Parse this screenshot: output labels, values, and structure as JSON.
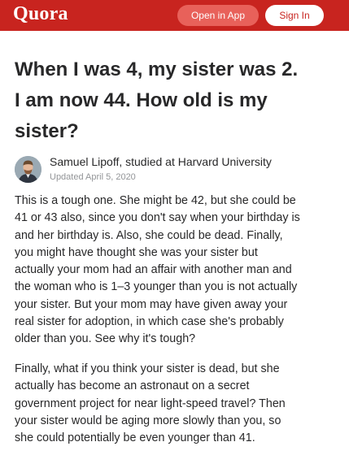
{
  "header": {
    "logo": "Quora",
    "open_app_label": "Open in App",
    "sign_in_label": "Sign In",
    "brand_color": "#c8241f"
  },
  "question": {
    "lines": [
      "When I was 4, my sister was 2.",
      "I am now 44. How old is my",
      "sister?"
    ]
  },
  "answer": {
    "author_line": "Samuel Lipoff, studied at Harvard University",
    "updated": "Updated April 5, 2020",
    "paragraphs": [
      {
        "lines": [
          "This is a tough one. She might be 42, but she could be",
          "41 or 43 also, since you don't say when your birthday is",
          "and her birthday is. Also, she could be dead. Finally,",
          "you might have thought she was your sister but",
          "actually your mom had an affair with another man and",
          "the woman who is 1–3 younger than you is not actually",
          "your sister. But your mom may have given away your",
          "real sister for adoption, in which case she's probably",
          "older than you. See why it's tough?"
        ]
      },
      {
        "lines": [
          "Finally, what if you think your sister is dead, but she",
          "actually has become an astronaut on a secret",
          "government project for near light-speed travel? Then",
          "your sister would be aging more slowly than you, so",
          "she could potentially be even younger than 41."
        ]
      }
    ]
  }
}
